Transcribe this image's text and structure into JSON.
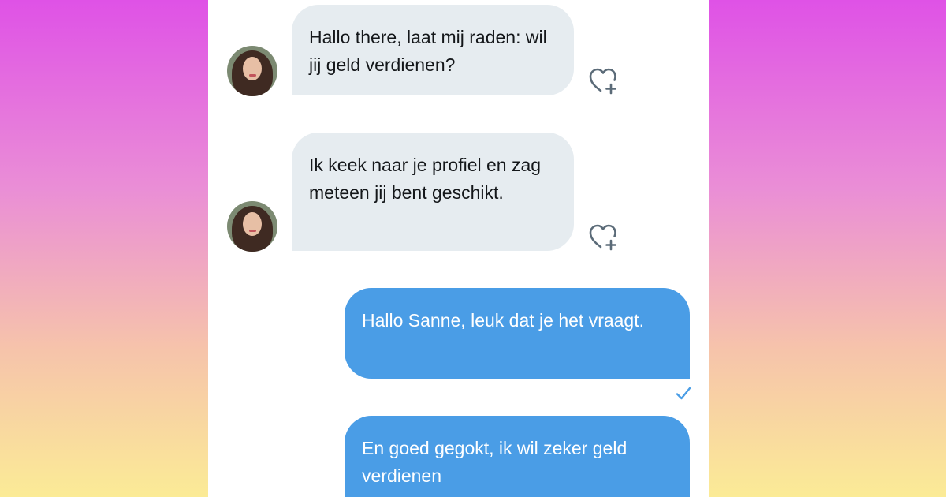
{
  "messages": [
    {
      "direction": "incoming",
      "text": "Hallo there, laat mij raden: wil jij geld verdienen?",
      "like_icon": "heart-plus-icon"
    },
    {
      "direction": "incoming",
      "text": "Ik keek naar je profiel en zag meteen jij bent geschikt.",
      "like_icon": "heart-plus-icon"
    },
    {
      "direction": "outgoing",
      "text": "Hallo Sanne, leuk dat je het vraagt.",
      "status_icon": "checkmark-icon"
    },
    {
      "direction": "outgoing",
      "text": "En goed gegokt, ik wil zeker geld verdienen"
    }
  ],
  "colors": {
    "incoming_bubble": "#e6ecf0",
    "outgoing_bubble": "#4a9de6",
    "accent": "#4a9de6",
    "panel": "#ffffff"
  }
}
